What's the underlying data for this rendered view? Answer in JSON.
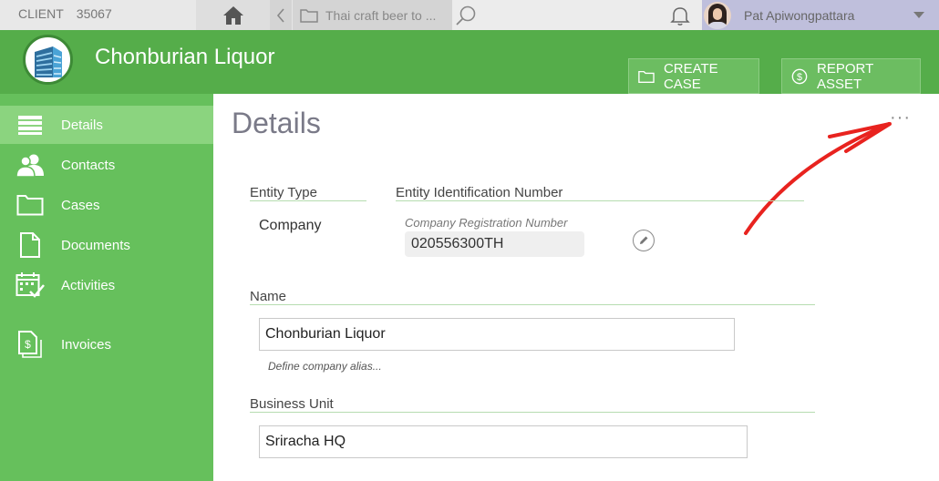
{
  "topbar": {
    "client_label": "CLIENT",
    "client_number": "35067",
    "breadcrumb_text": "Thai craft beer to ...",
    "user_name": "Pat Apiwongpattara"
  },
  "header": {
    "org_name": "Chonburian Liquor",
    "create_case_label": "CREATE CASE",
    "report_asset_label": "REPORT ASSET"
  },
  "sidebar": {
    "items": [
      {
        "label": "Details",
        "icon": "list-icon",
        "active": true
      },
      {
        "label": "Contacts",
        "icon": "contacts-icon"
      },
      {
        "label": "Cases",
        "icon": "folder-icon"
      },
      {
        "label": "Documents",
        "icon": "document-icon"
      },
      {
        "label": "Activities",
        "icon": "calendar-check-icon"
      },
      {
        "label": "Invoices",
        "icon": "invoice-icon"
      }
    ]
  },
  "main": {
    "title": "Details",
    "more_label": "···",
    "entity_type_label": "Entity Type",
    "entity_type_value": "Company",
    "entity_id_label": "Entity Identification Number",
    "reg_number_label": "Company Registration Number",
    "reg_number_value": "020556300TH",
    "name_label": "Name",
    "name_value": "Chonburian Liquor",
    "alias_hint": "Define company alias...",
    "business_unit_label": "Business Unit",
    "business_unit_value": "Sriracha HQ"
  },
  "colors": {
    "header_green": "#55ad4a",
    "sidebar_green": "#66c05c",
    "active_item": "#8bd47f",
    "annotation_arrow": "#e8231f"
  }
}
